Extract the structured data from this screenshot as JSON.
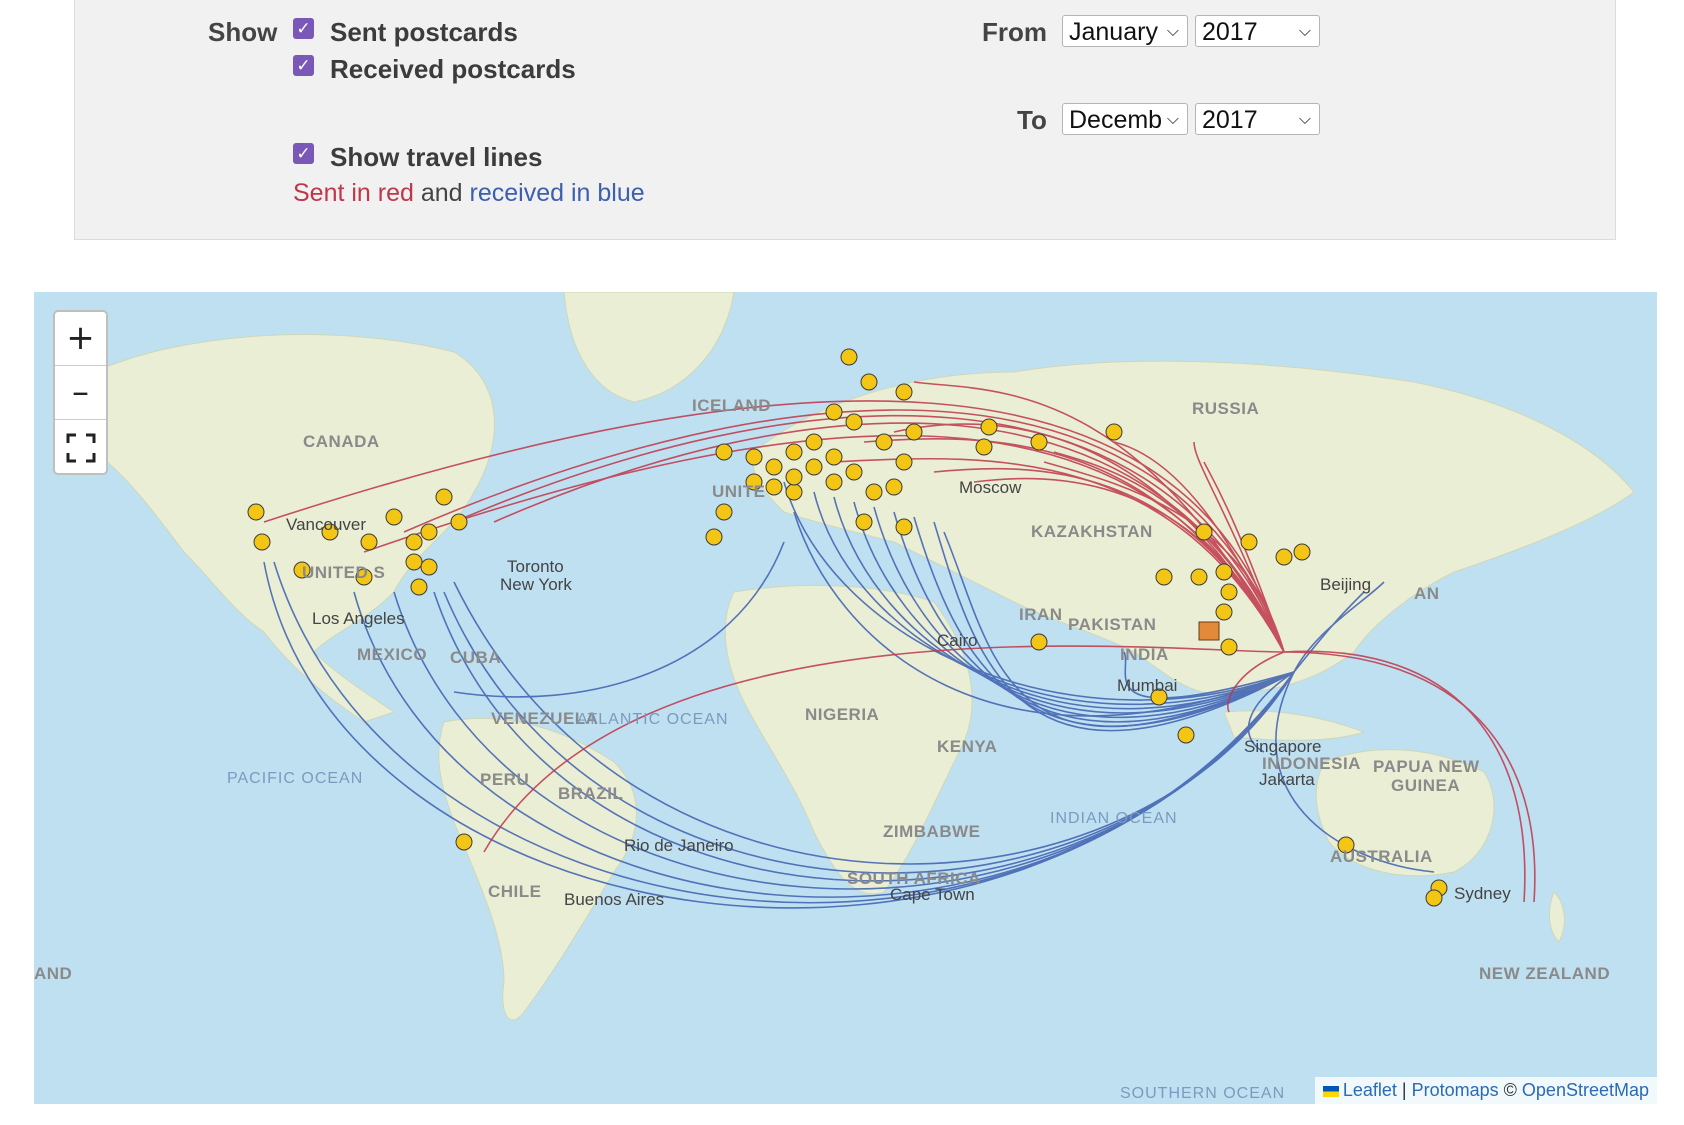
{
  "filters": {
    "show_label": "Show",
    "sent_label": "Sent postcards",
    "received_label": "Received postcards",
    "travel_label": "Show travel lines",
    "legend": {
      "sent": "Sent in red",
      "and": "and",
      "received": "received in blue"
    },
    "from_label": "From",
    "from_month": "January",
    "from_year": "2017",
    "to_label": "To",
    "to_month": "December",
    "to_year": "2017",
    "sent_color": "#c0364a",
    "received_color": "#3d5fb0"
  },
  "map": {
    "zoom_in": "+",
    "zoom_out": "–",
    "fullscreen_icon": "fullscreen-icon",
    "attribution": {
      "leaflet": "Leaflet",
      "sep": "|",
      "protomaps": "Protomaps",
      "copy": "©",
      "osm": "OpenStreetMap"
    },
    "labels": {
      "russia": "RUSSIA",
      "canada": "CANADA",
      "iceland": "ICELAND",
      "united_kingdom": "UNITE",
      "kazakhstan": "KAZAKHSTAN",
      "pakistan": "PAKISTAN",
      "india": "INDIA",
      "iran": "IRAN",
      "nigeria": "NIGERIA",
      "kenya": "KENYA",
      "zimbabwe": "ZIMBABWE",
      "south_africa": "SOUTH AFRICA",
      "brazil": "BRAZIL",
      "peru": "PERU",
      "venezuela": "VENEZUELA",
      "mexico": "MEXICO",
      "cuba": "CUBA",
      "chile": "CHILE",
      "australia": "AUSTRALIA",
      "papua": "PAPUA NEW",
      "guinea": "GUINEA",
      "indonesia": "INDONESIA",
      "new_zealand": "NEW ZEALAND",
      "and": "AND",
      "japan": "AN",
      "united_states": "UNITED S"
    },
    "oceans": {
      "pacific": "PACIFIC OCEAN",
      "atlantic": "ATLANTIC OCEAN",
      "indian": "INDIAN OCEAN",
      "southern": "SOUTHERN OCEAN"
    },
    "cities": {
      "vancouver": "Vancouver",
      "los_angeles": "Los Angeles",
      "toronto": "Toronto",
      "new_york": "New York",
      "moscow": "Moscow",
      "cairo": "Cairo",
      "mumbai": "Mumbai",
      "beijing": "Beijing",
      "singapore": "Singapore",
      "jakarta": "Jakarta",
      "sydney": "Sydney",
      "rio": "Rio de Janeiro",
      "buenos_aires": "Buenos Aires",
      "cape_town": "Cape Town"
    }
  }
}
